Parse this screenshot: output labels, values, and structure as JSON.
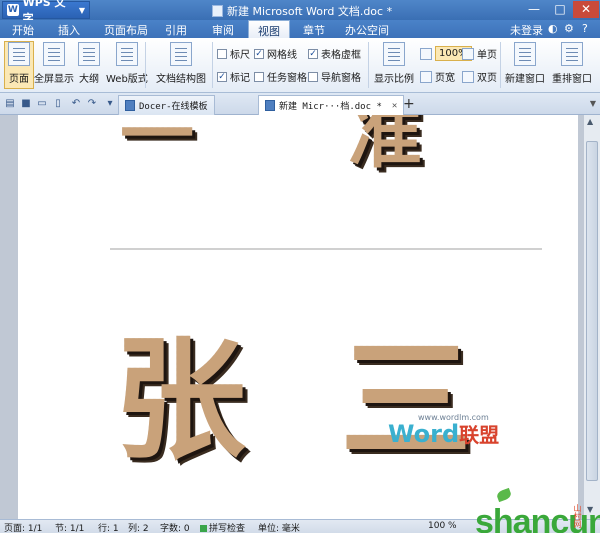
{
  "app": {
    "name": "WPS 文字",
    "logo": "W"
  },
  "window": {
    "title": "新建 Microsoft Word 文档.doc *",
    "controls": [
      "—",
      "□",
      "✕"
    ]
  },
  "menu": {
    "items": [
      "开始",
      "插入",
      "页面布局",
      "引用",
      "审阅",
      "视图",
      "章节",
      "办公空间"
    ],
    "active": "视图",
    "login": "未登录",
    "right_icons": [
      "?"
    ]
  },
  "ribbon": {
    "view_modes": [
      "页面",
      "全屏显示",
      "大纲",
      "Web版式"
    ],
    "doc_structure": "文档结构图",
    "checkboxes": [
      {
        "label": "标尺",
        "checked": false
      },
      {
        "label": "网格线",
        "checked": true
      },
      {
        "label": "表格虚框",
        "checked": true
      },
      {
        "label": "标记",
        "checked": true
      },
      {
        "label": "任务窗格",
        "checked": false
      },
      {
        "label": "导航窗格",
        "checked": false
      }
    ],
    "zoom": {
      "label": "显示比例",
      "value": "100%",
      "single_page": "单页",
      "page_width": "页宽",
      "double_page": "双页"
    },
    "new_window": "新建窗口",
    "arrange": "重排窗口"
  },
  "tabs": [
    {
      "label": "Docer-在线模板",
      "active": false
    },
    {
      "label": "新建 Micr···档.doc *",
      "active": true
    }
  ],
  "document": {
    "top_chars": [
      "一",
      "准"
    ],
    "bottom_chars": [
      "张",
      "三"
    ],
    "watermark_url": "www.wordlm.com",
    "watermark_brand": "Word",
    "watermark_brand_cn": "联盟"
  },
  "status": {
    "page": "页面: 1/1",
    "section": "节: 1/1",
    "row": "行: 1",
    "col": "列: 2",
    "chars": "字数: 0",
    "spell": "拼写检查",
    "unit": "单位: 毫米",
    "zoom": "100 %"
  },
  "brand": {
    "text": "shancun",
    "net": "山村网"
  }
}
